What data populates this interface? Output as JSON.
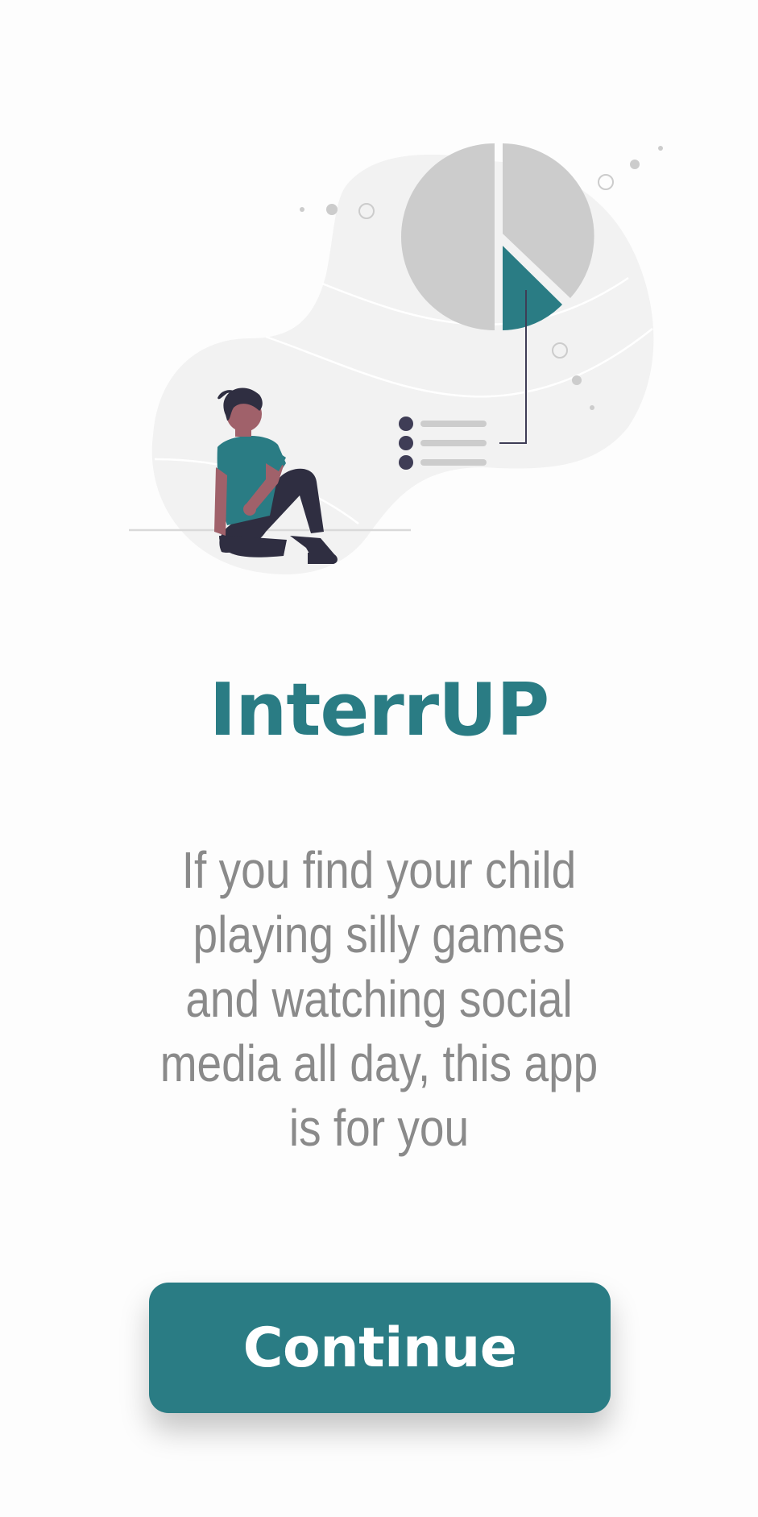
{
  "app": {
    "title": "InterrUP",
    "description": "If you find your child playing silly games and watching social media all day, this app is for you"
  },
  "actions": {
    "continue_label": "Continue"
  },
  "illustration": {
    "name": "person-with-pie-chart-illustration",
    "colors": {
      "accent": "#2a7c84",
      "blob": "#f2f2f2",
      "pie_gray": "#cccccc",
      "dark": "#2f2e41",
      "skin": "#a0616a"
    }
  },
  "theme": {
    "accent": "#2a7c84",
    "text_muted": "#8a8a8a",
    "background": "#fdfdfd"
  }
}
